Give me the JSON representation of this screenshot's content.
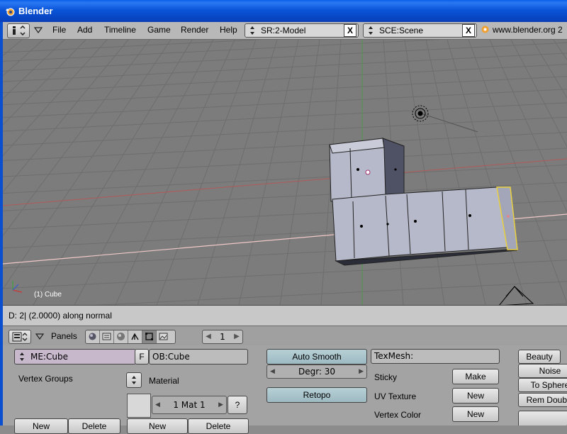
{
  "window": {
    "title": "Blender"
  },
  "menubar": {
    "items": [
      "File",
      "Add",
      "Timeline",
      "Game",
      "Render",
      "Help"
    ],
    "screen_field": "SR:2-Model",
    "scene_field": "SCE:Scene",
    "close_glyph": "X",
    "url": "www.blender.org 2"
  },
  "viewport": {
    "object_label": "(1) Cube",
    "axis_x_color": "#c86a6a",
    "axis_y_color": "#5fa85f",
    "grid_color": "#707070",
    "background": "#7c7c7c"
  },
  "infoline": {
    "text": "D: 2| (2.0000) along normal"
  },
  "panelbar": {
    "label": "Panels",
    "page": "1",
    "tabs": [
      "shading-icon",
      "object-icon",
      "material-icon",
      "physics-icon",
      "editing-icon",
      "scene-icon"
    ]
  },
  "mesh_panel": {
    "me_field": "ME:Cube",
    "f_button": "F",
    "ob_field": "OB:Cube",
    "vertex_groups_label": "Vertex Groups",
    "material_label": "Material",
    "material_slot": "1 Mat 1",
    "help_button": "?",
    "new_button": "New",
    "delete_button": "Delete"
  },
  "modifiers_panel": {
    "auto_smooth": "Auto Smooth",
    "degr": "Degr: 30",
    "retopo": "Retopo",
    "texmesh": "TexMesh:",
    "sticky_label": "Sticky",
    "sticky_button": "Make",
    "uv_label": "UV Texture",
    "uv_button": "New",
    "vcol_label": "Vertex Color",
    "vcol_button": "New"
  },
  "tools_panel": {
    "beauty": "Beauty",
    "noise": "Noise",
    "to_sphere": "To Sphere",
    "rem_double": "Rem Double"
  }
}
